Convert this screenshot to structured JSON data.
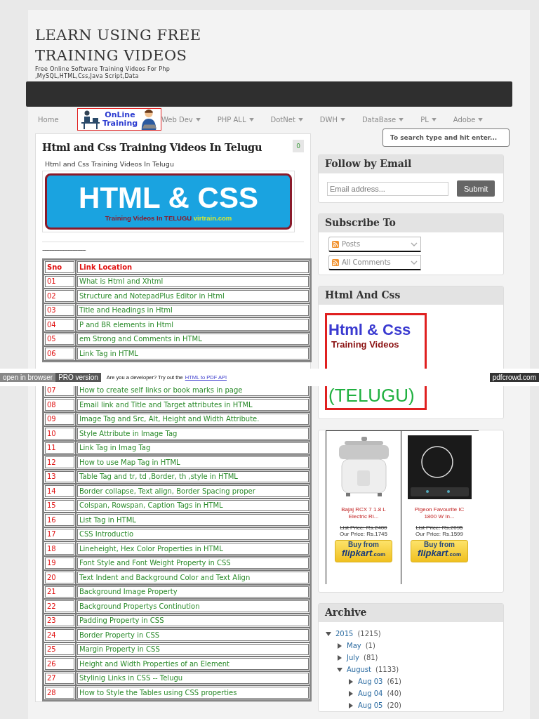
{
  "site": {
    "title": "LEARN USING FREE TRAINING VIDEOS",
    "tagline": "Free Online Software Training Videos For Php ,MySQL,HTML,Css,Java Script,Data"
  },
  "nav": {
    "logo": {
      "line1": "OnLine",
      "line2": "Training"
    },
    "items": [
      {
        "label": "Home",
        "has_menu": false
      },
      {
        "label": "Web Dev",
        "has_menu": true
      },
      {
        "label": "PHP ALL",
        "has_menu": true
      },
      {
        "label": "DotNet",
        "has_menu": true
      },
      {
        "label": "DWH",
        "has_menu": true
      },
      {
        "label": "DataBase",
        "has_menu": true
      },
      {
        "label": "PL",
        "has_menu": true
      },
      {
        "label": "Adobe",
        "has_menu": true
      }
    ]
  },
  "search": {
    "placeholder": "To search type and hit enter..."
  },
  "post": {
    "title": "Html and Css Training Videos In Telugu",
    "comments": "0",
    "caption": "Html and Css Training Videos In Telugu",
    "banner": {
      "headline": "HTML & CSS",
      "tagline": "Training Videos In TELUGU",
      "site": "virtrain.com"
    },
    "separator": "-----------------------------------",
    "table": {
      "columns": [
        "Sno",
        "Link Location"
      ],
      "rows": [
        {
          "sno": "01",
          "title": " What is Html and Xhtml"
        },
        {
          "sno": "02",
          "title": "Structure and NotepadPlus Editor in Html"
        },
        {
          "sno": "03",
          "title": "Title and Headings in Html"
        },
        {
          "sno": "04",
          "title": "P and BR elements in Html"
        },
        {
          "sno": "05",
          "title": "em Strong and Comments in HTML"
        },
        {
          "sno": "06",
          "title": "Link Tag in HTML"
        },
        {
          "sno": "07",
          "title": "How to create self links or book marks in page"
        },
        {
          "sno": "08",
          "title": "Email link and Title and Target attributes in HTML"
        },
        {
          "sno": "09",
          "title": "Image Tag and Src, Alt, Height and Width Attribute."
        },
        {
          "sno": "10",
          "title": "Style Attribute in Image Tag"
        },
        {
          "sno": "11",
          "title": "Link Tag in Imag Tag"
        },
        {
          "sno": "12",
          "title": "How to use Map Tag in HTML"
        },
        {
          "sno": "13",
          "title": "Table Tag and tr, td ,Border, th ,style in HTML"
        },
        {
          "sno": "14",
          "title": "Border collapse, Text align, Border Spacing proper"
        },
        {
          "sno": "15",
          "title": "Colspan, Rowspan, Caption Tags in HTML"
        },
        {
          "sno": "16",
          "title": "List Tag in HTML"
        },
        {
          "sno": "17",
          "title": "CSS Introductio"
        },
        {
          "sno": "18",
          "title": "Lineheight, Hex Color Properties in HTML"
        },
        {
          "sno": "19",
          "title": "Font Style and Font Weight Property in CSS"
        },
        {
          "sno": "20",
          "title": "Text Indent and Background Color and Text Align"
        },
        {
          "sno": "21",
          "title": "Background Image Property"
        },
        {
          "sno": "22",
          "title": "Background Propertys Continution"
        },
        {
          "sno": "23",
          "title": "Padding Property in CSS"
        },
        {
          "sno": "24",
          "title": "Border Property in CSS"
        },
        {
          "sno": "25",
          "title": "Margin Property in CSS"
        },
        {
          "sno": "26",
          "title": "Height and Width Properties of an Element"
        },
        {
          "sno": "27",
          "title": "Stylinig Links in CSS -- Telugu"
        },
        {
          "sno": "28",
          "title": "How to Style the Tables using CSS properties"
        }
      ]
    }
  },
  "sidebar": [
    {
      "kind": "email",
      "title": "Follow by Email",
      "placeholder": "Email address...",
      "button": "Submit"
    },
    {
      "kind": "subscribe",
      "title": "Subscribe To",
      "feeds": [
        "Posts",
        "All Comments"
      ]
    },
    {
      "title": "Html And Css",
      "headline": "Html & Css",
      "tagline": "Training Videos",
      "language": "(TELUGU)"
    },
    {
      "kind": "products",
      "products": [
        {
          "kind": "cooker",
          "name": "Bajaj RCX 7 1.8 L Electric Ri...",
          "list_price": "List Price: Rs.2400",
          "our_price": "Our Price: Rs.1745",
          "buy": "Buy from",
          "store": "flipkart",
          "store_suffix": ".com"
        },
        {
          "kind": "cooktop",
          "name": "Pigeon Favourite IC 1800 W In...",
          "list_price": "List Price: Rs.2095",
          "our_price": "Our Price: Rs.1599",
          "buy": "Buy from",
          "store": "flipkart",
          "store_suffix": ".com"
        }
      ]
    },
    {
      "kind": "archive",
      "title": "Archive",
      "tree": [
        {
          "label": "2015",
          "count": "(1215)",
          "expanded": true,
          "children": [
            {
              "label": "May",
              "count": "(1)",
              "expanded": false
            },
            {
              "label": "July",
              "count": "(81)",
              "expanded": false
            },
            {
              "label": "August",
              "count": "(1133)",
              "expanded": true,
              "children": [
                {
                  "label": "Aug 03",
                  "count": "(61)",
                  "expanded": false
                },
                {
                  "label": "Aug 04",
                  "count": "(40)",
                  "expanded": false
                },
                {
                  "label": "Aug 05",
                  "count": "(20)",
                  "expanded": false
                }
              ]
            }
          ]
        }
      ]
    }
  ],
  "pdf_bar": {
    "buttons": [
      "open in browser",
      "PRO version"
    ],
    "promo": "Are you a developer? Try out the",
    "link": "HTML to PDF API",
    "brand": "pdfcrowd.com"
  }
}
